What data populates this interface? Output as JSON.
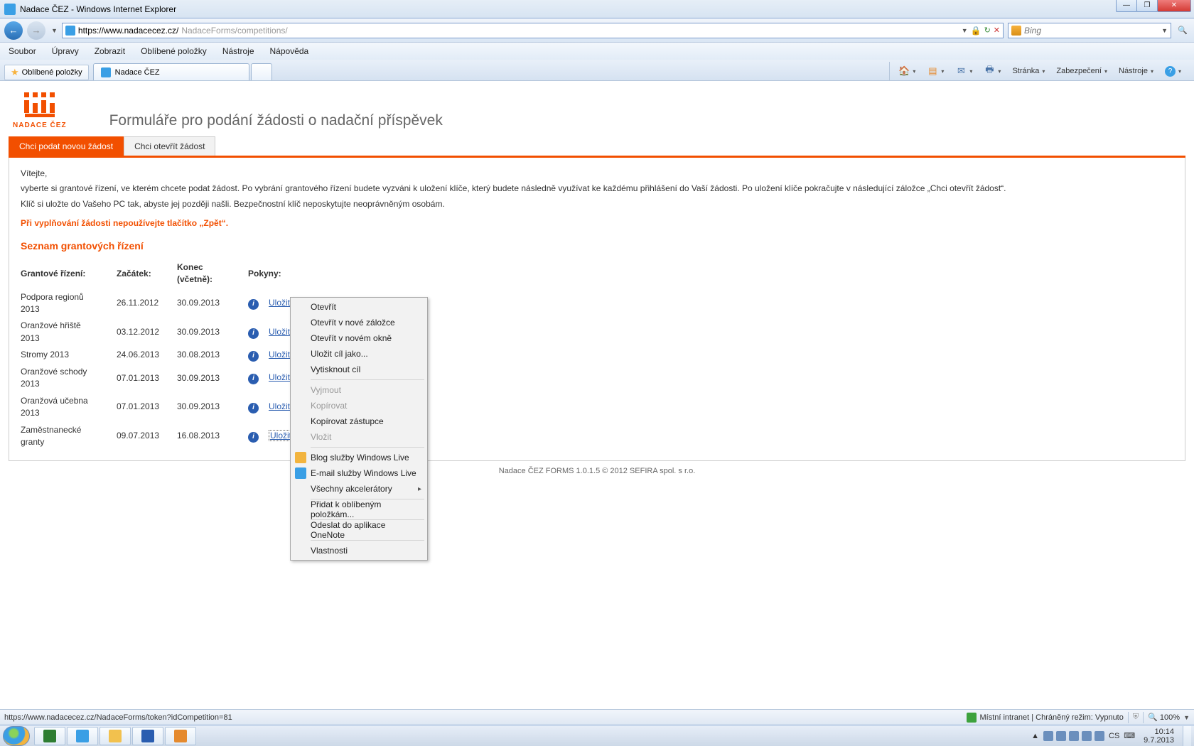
{
  "window": {
    "title": "Nadace ČEZ - Windows Internet Explorer"
  },
  "win_buttons": {
    "min": "—",
    "max": "❐",
    "close": "✕"
  },
  "nav": {
    "url_prefix": "https://www.nadacecez.cz/",
    "url_suffix": "NadaceForms/competitions/",
    "search_placeholder": "Bing"
  },
  "menus": [
    "Soubor",
    "Úpravy",
    "Zobrazit",
    "Oblíbené položky",
    "Nástroje",
    "Nápověda"
  ],
  "favorites_button": "Oblíbené položky",
  "tab_title": "Nadace ČEZ",
  "command_bar": {
    "page": "Stránka",
    "security": "Zabezpečení",
    "tools": "Nástroje"
  },
  "logo_text": "NADACE ČEZ",
  "page_title": "Formuláře pro podání žádosti o nadační příspěvek",
  "page_tabs": {
    "active": "Chci podat novou žádost",
    "other": "Chci otevřít žádost"
  },
  "intro": {
    "l1": "Vítejte,",
    "l2": "vyberte si grantové řízení, ve kterém chcete podat žádost. Po vybrání grantového řízení budete vyzváni k uložení klíče, který budete následně využívat ke každému přihlášení do Vaší žádosti. Po uložení klíče pokračujte v následující záložce „Chci otevřít žádost“.",
    "l3": "Klíč si uložte do Vašeho PC tak, abyste jej později našli. Bezpečnostní klíč neposkytujte neoprávněným osobám."
  },
  "warning": "Při vyplňování žádosti nepoužívejte tlačítko „Zpět“.",
  "list_title": "Seznam grantových řízení",
  "cols": {
    "c1": "Grantové řízení:",
    "c2": "Začátek:",
    "c3": "Konec (včetně):",
    "c4": "Pokyny:"
  },
  "link_label": "Uložit klíč",
  "rows": [
    {
      "name": "Podpora regionů 2013",
      "start": "26.11.2012",
      "end": "30.09.2013"
    },
    {
      "name": "Oranžové hřiště 2013",
      "start": "03.12.2012",
      "end": "30.09.2013"
    },
    {
      "name": "Stromy 2013",
      "start": "24.06.2013",
      "end": "30.08.2013"
    },
    {
      "name": "Oranžové schody 2013",
      "start": "07.01.2013",
      "end": "30.09.2013"
    },
    {
      "name": "Oranžová učebna 2013",
      "start": "07.01.2013",
      "end": "30.09.2013"
    },
    {
      "name": "Zaměstnanecké granty",
      "start": "09.07.2013",
      "end": "16.08.2013"
    }
  ],
  "footer": "Nadace ČEZ FORMS 1.0.1.5 © 2012 SEFIRA spol. s r.o.",
  "ctx": {
    "open": "Otevřít",
    "newtab": "Otevřít v nové záložce",
    "newwin": "Otevřít v novém okně",
    "saveas": "Uložit cíl jako...",
    "print": "Vytisknout cíl",
    "cut": "Vyjmout",
    "copy": "Kopírovat",
    "shortcut": "Kopírovat zástupce",
    "paste": "Vložit",
    "blog": "Blog služby Windows Live",
    "email": "E-mail služby Windows Live",
    "accel": "Všechny akcelerátory",
    "addfav": "Přidat k oblíbeným položkám...",
    "onenote": "Odeslat do aplikace OneNote",
    "props": "Vlastnosti"
  },
  "status": {
    "url": "https://www.nadacecez.cz/NadaceForms/token?idCompetition=81",
    "zone": "Místní intranet | Chráněný režim: Vypnuto",
    "zoom": "100%"
  },
  "tray": {
    "lang": "CS",
    "time": "10:14",
    "date": "9.7.2013"
  }
}
